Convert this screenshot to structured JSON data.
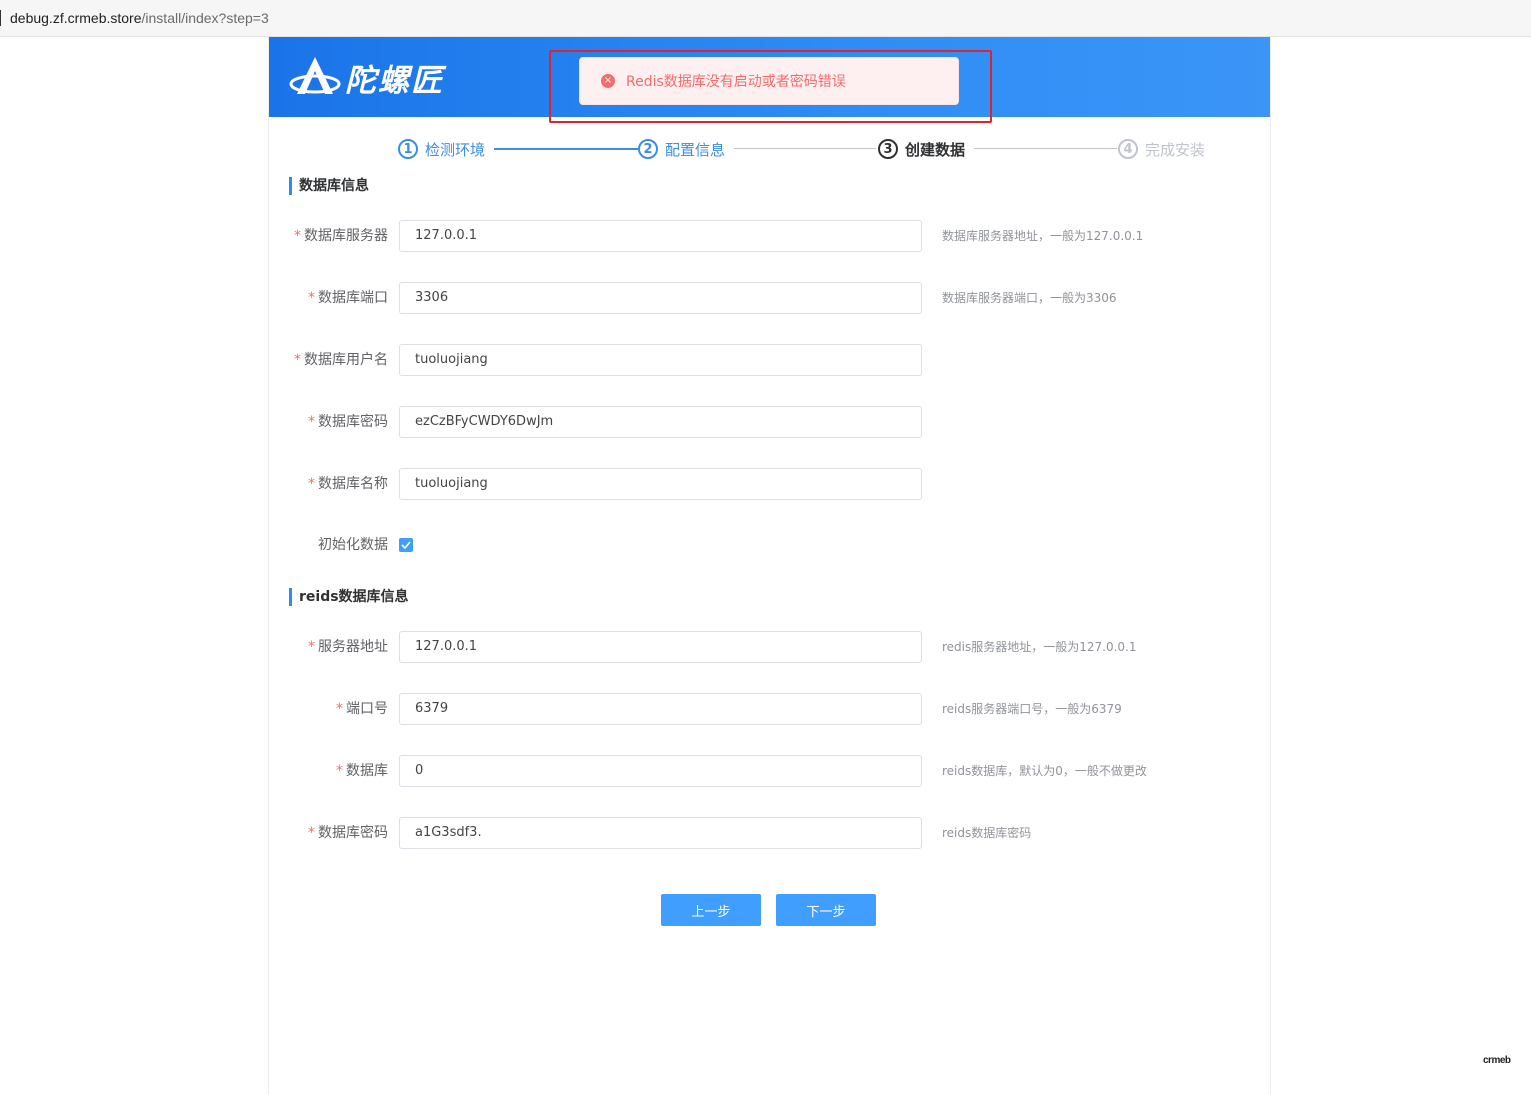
{
  "browser": {
    "url_domain": "debug.zf.crmeb.store",
    "url_path": "/install/index?step=3"
  },
  "brand": {
    "logo_text": "陀螺匠"
  },
  "toast": {
    "message": "Redis数据库没有启动或者密码错误",
    "icon": "error-circle-icon",
    "icon_glyph": "×"
  },
  "steps": [
    {
      "num": "1",
      "label": "检测环境",
      "status": "done"
    },
    {
      "num": "2",
      "label": "配置信息",
      "status": "done"
    },
    {
      "num": "3",
      "label": "创建数据",
      "status": "active"
    },
    {
      "num": "4",
      "label": "完成安装",
      "status": "wait"
    }
  ],
  "db_section": {
    "title": "数据库信息",
    "fields": [
      {
        "label": "数据库服务器",
        "value": "127.0.0.1",
        "hint": "数据库服务器地址，一般为127.0.0.1",
        "required": true
      },
      {
        "label": "数据库端口",
        "value": "3306",
        "hint": "数据库服务器端口，一般为3306",
        "required": true
      },
      {
        "label": "数据库用户名",
        "value": "tuoluojiang",
        "hint": "",
        "required": true
      },
      {
        "label": "数据库密码",
        "value": "ezCzBFyCWDY6DwJm",
        "hint": "",
        "required": true
      },
      {
        "label": "数据库名称",
        "value": "tuoluojiang",
        "hint": "",
        "required": true
      }
    ],
    "init_label": "初始化数据",
    "init_checked": true
  },
  "redis_section": {
    "title": "reids数据库信息",
    "fields": [
      {
        "label": "服务器地址",
        "value": "127.0.0.1",
        "hint": "redis服务器地址，一般为127.0.0.1",
        "required": true
      },
      {
        "label": "端口号",
        "value": "6379",
        "hint": "reids服务器端口号，一般为6379",
        "required": true
      },
      {
        "label": "数据库",
        "value": "0",
        "hint": "reids数据库，默认为0，一般不做更改",
        "required": true
      },
      {
        "label": "数据库密码",
        "value": "a1G3sdf3.",
        "hint": "reids数据库密码",
        "required": true
      }
    ]
  },
  "buttons": {
    "prev": "上一步",
    "next": "下一步"
  },
  "footer": {
    "corner_logo": "crmeb"
  },
  "colors": {
    "primary": "#409eff",
    "banner": "#2f8df5",
    "error": "#f56c6c"
  }
}
